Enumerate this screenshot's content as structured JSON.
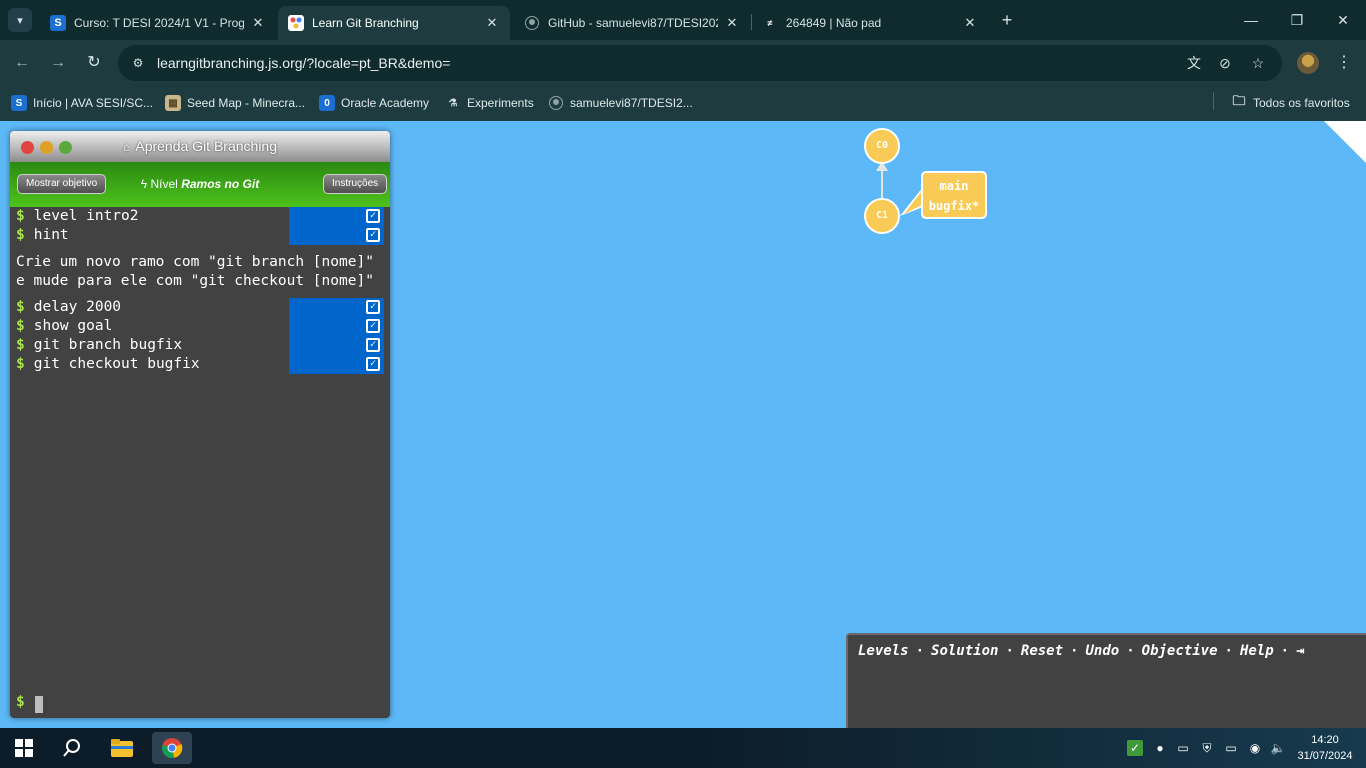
{
  "browser": {
    "tabs": [
      {
        "title": "Curso: T DESI 2024/1 V1 - Progr",
        "favicon": "S"
      },
      {
        "title": "Learn Git Branching",
        "favicon": "git"
      },
      {
        "title": "GitHub - samuelevi87/TDESI202",
        "favicon": "github-icon"
      },
      {
        "title": "264849 | Não pad",
        "favicon": "N/A"
      }
    ],
    "url": "learngitbranching.js.org/?locale=pt_BR&demo=",
    "bookmarks": [
      {
        "label": "Início | AVA SESI/SC...",
        "icon": "S"
      },
      {
        "label": "Seed Map - Minecra...",
        "icon": "seed-icon"
      },
      {
        "label": "Oracle Academy",
        "icon": "0"
      },
      {
        "label": "Experiments",
        "icon": "flask-icon"
      },
      {
        "label": "samuelevi87/TDESI2...",
        "icon": "github-icon"
      }
    ],
    "all_bookmarks": "Todos os favoritos"
  },
  "terminal": {
    "title": "Aprenda Git Branching",
    "show_goal_button": "Mostrar objetivo",
    "level_prefix": "Nível",
    "level_name": "Ramos no Git",
    "instructions_button": "Instruções",
    "commands_before": [
      "level intro2",
      "hint"
    ],
    "hint_lines": [
      "Crie um novo ramo com \"git branch [nome]\"",
      "e mude para ele com \"git checkout [nome]\""
    ],
    "commands_after": [
      "delay 2000",
      "show goal",
      "git branch bugfix",
      "git checkout bugfix"
    ],
    "prompt": "$"
  },
  "graph": {
    "commits": [
      "C0",
      "C1"
    ],
    "branch_labels": [
      "main",
      "bugfix*"
    ],
    "colors": {
      "commit": "#f9cb56",
      "background": "#5cb8f7"
    }
  },
  "command_bar": {
    "links": [
      "Levels",
      "Solution",
      "Reset",
      "Undo",
      "Objective",
      "Help"
    ]
  },
  "taskbar": {
    "time": "14:20",
    "date": "31/07/2024"
  }
}
